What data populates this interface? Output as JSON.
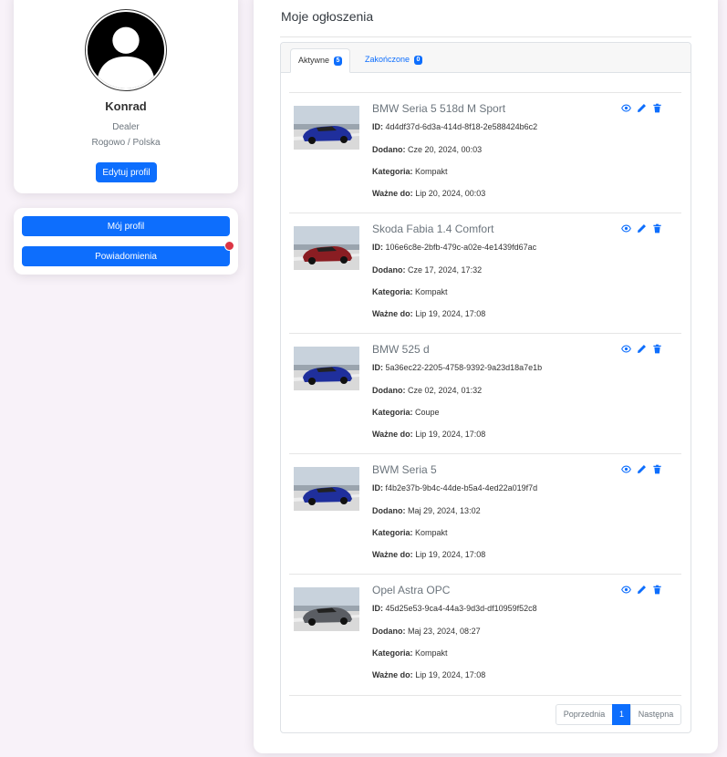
{
  "profile": {
    "name": "Konrad",
    "role": "Dealer",
    "location": "Rogowo / Polska",
    "edit_label": "Edytuj profil",
    "avatar_icon": "user-silhouette-icon"
  },
  "nav": {
    "my_profile_label": "Mój profil",
    "notifications_label": "Powiadomienia",
    "notification_dot_color": "#dc3545"
  },
  "main": {
    "title": "Moje ogłoszenia",
    "tabs": [
      {
        "label": "Aktywne",
        "count": "5"
      },
      {
        "label": "Zakończone",
        "count": "0"
      }
    ],
    "field_labels": {
      "id": "ID:",
      "added": "Dodano:",
      "category": "Kategoria:",
      "valid": "Ważne do:"
    },
    "listings": [
      {
        "title": "BMW Seria 5 518d M Sport",
        "id": "4d4df37d-6d3a-414d-8f18-2e588424b6c2",
        "added": "Cze 20, 2024, 00:03",
        "category": "Kompakt",
        "valid": "Lip 20, 2024, 00:03",
        "car_color": "#1f2f9c"
      },
      {
        "title": "Skoda Fabia 1.4 Comfort",
        "id": "106e6c8e-2bfb-479c-a02e-4e1439fd67ac",
        "added": "Cze 17, 2024, 17:32",
        "category": "Kompakt",
        "valid": "Lip 19, 2024, 17:08",
        "car_color": "#8a1d22"
      },
      {
        "title": "BMW 525 d",
        "id": "5a36ec22-2205-4758-9392-9a23d18a7e1b",
        "added": "Cze 02, 2024, 01:32",
        "category": "Coupe",
        "valid": "Lip 19, 2024, 17:08",
        "car_color": "#1f2f9c"
      },
      {
        "title": "BWM Seria 5",
        "id": "f4b2e37b-9b4c-44de-b5a4-4ed22a019f7d",
        "added": "Maj 29, 2024, 13:02",
        "category": "Kompakt",
        "valid": "Lip 19, 2024, 17:08",
        "car_color": "#1f2f9c"
      },
      {
        "title": "Opel Astra OPC",
        "id": "45d25e53-9ca4-44a3-9d3d-df10959f52c8",
        "added": "Maj 23, 2024, 08:27",
        "category": "Kompakt",
        "valid": "Lip 19, 2024, 17:08",
        "car_color": "#5a5d63"
      }
    ],
    "action_icons": [
      "eye-icon",
      "pencil-icon",
      "trash-icon"
    ],
    "pagination": {
      "prev": "Poprzednia",
      "current": "1",
      "next": "Następna"
    }
  },
  "colors": {
    "primary": "#0d6efd",
    "background": "#f8f2f9"
  }
}
